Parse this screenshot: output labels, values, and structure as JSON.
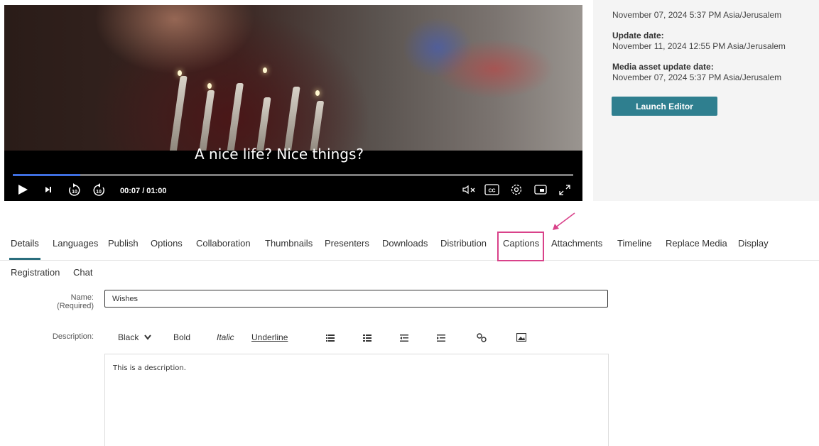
{
  "player": {
    "subtitle": "A nice life? Nice things?",
    "timecode": "00:07 / 01:00",
    "progress_fraction": 0.12,
    "skip_back_label": "10",
    "skip_forward_label": "10",
    "cc_label": "CC"
  },
  "info": {
    "creation_value": "November 07, 2024 5:37 PM Asia/Jerusalem",
    "update_label": "Update date:",
    "update_value": "November 11, 2024 12:55 PM Asia/Jerusalem",
    "media_update_label": "Media asset update date:",
    "media_update_value": "November 07, 2024 5:37 PM Asia/Jerusalem",
    "launch_editor": "Launch Editor"
  },
  "tabs": [
    "Details",
    "Languages",
    "Publish",
    "Options",
    "Collaboration",
    "Thumbnails",
    "Presenters",
    "Downloads",
    "Distribution",
    "Captions",
    "Attachments",
    "Timeline",
    "Replace Media",
    "Display"
  ],
  "tabs_row2": [
    "Registration",
    "Chat"
  ],
  "form": {
    "name_label": "Name:",
    "name_required": "(Required)",
    "name_value": "Wishes",
    "description_label": "Description:",
    "color_select": "Black",
    "bold": "Bold",
    "italic": "Italic",
    "underline": "Underline",
    "description_text": "This is a description."
  },
  "colors": {
    "accent": "#2f7f8f",
    "highlight": "#d9428a",
    "progress": "#3f6fe0"
  }
}
